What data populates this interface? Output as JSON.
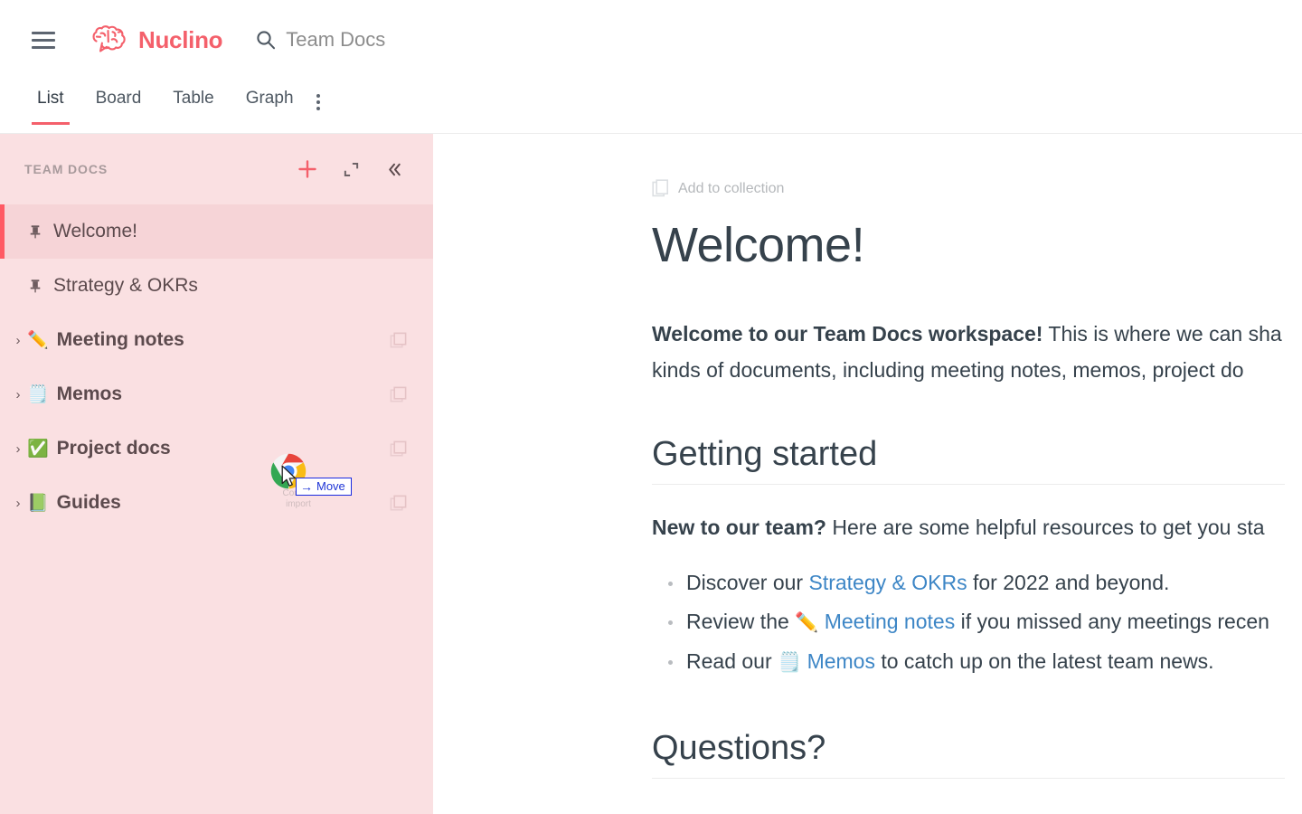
{
  "colors": {
    "brand": "#f4606b",
    "sidebar_bg": "#fae0e2",
    "sidebar_active_bg": "#f6d4d7",
    "active_marker": "#ff5a64",
    "link": "#3d86c6",
    "text": "#36424c",
    "move_badge": "#1f35d6"
  },
  "topbar": {
    "menu_icon": "hamburger-menu-icon",
    "logo_icon": "nuclino-brain-logo-icon",
    "brand_name": "Nuclino",
    "search_icon": "search-icon",
    "search_value": "Team Docs"
  },
  "tabs": {
    "items": [
      {
        "label": "List",
        "active": true
      },
      {
        "label": "Board",
        "active": false
      },
      {
        "label": "Table",
        "active": false
      },
      {
        "label": "Graph",
        "active": false
      }
    ],
    "more_icon": "more-vertical-icon"
  },
  "sidebar": {
    "title": "TEAM DOCS",
    "actions": [
      {
        "name": "add-item-button",
        "icon": "plus-icon"
      },
      {
        "name": "expand-sidebar-button",
        "icon": "expand-icon"
      },
      {
        "name": "collapse-sidebar-button",
        "icon": "chevrons-left-icon"
      }
    ],
    "items": [
      {
        "label": "Welcome!",
        "icon": "pin-icon",
        "emoji": "",
        "caret": false,
        "active": true,
        "bold": false,
        "duplicate": false
      },
      {
        "label": "Strategy & OKRs",
        "icon": "pin-icon",
        "emoji": "",
        "caret": false,
        "active": false,
        "bold": false,
        "duplicate": false
      },
      {
        "label": "Meeting notes",
        "icon": "emoji",
        "emoji": "✏️",
        "caret": true,
        "active": false,
        "bold": true,
        "duplicate": true
      },
      {
        "label": "Memos",
        "icon": "emoji",
        "emoji": "🗒️",
        "caret": true,
        "active": false,
        "bold": true,
        "duplicate": true
      },
      {
        "label": "Project docs",
        "icon": "emoji",
        "emoji": "✅",
        "caret": true,
        "active": false,
        "bold": true,
        "duplicate": true
      },
      {
        "label": "Guides",
        "icon": "emoji",
        "emoji": "📗",
        "caret": true,
        "active": false,
        "bold": true,
        "duplicate": true
      }
    ]
  },
  "drag": {
    "icon": "chrome-browser-icon",
    "cursor": "arrow-cursor-icon",
    "badge_arrow": "→",
    "badge_label": "Move",
    "file_label_line1": "Content",
    "file_label_line2": "import"
  },
  "main": {
    "collection_icon": "collection-icon",
    "collection_label": "Add to collection",
    "title": "Welcome!",
    "intro_bold": "Welcome to our Team Docs workspace!",
    "intro_rest": " This is where we can sha",
    "intro_line2": "kinds of documents, including meeting notes, memos, project do",
    "section1_title": "Getting started",
    "section1_lead_bold": "New to our team?",
    "section1_lead_rest": " Here are some helpful resources to get you sta",
    "bullets": [
      {
        "pre": "Discover our ",
        "emoji": "",
        "link": "Strategy & OKRs",
        "post": " for 2022 and beyond."
      },
      {
        "pre": "Review the ",
        "emoji": "✏️",
        "link": "Meeting notes",
        "post": " if you missed any meetings recen"
      },
      {
        "pre": "Read our ",
        "emoji": "🗒️",
        "link": "Memos",
        "post": " to catch up on the latest team news."
      }
    ],
    "section2_title": "Questions?"
  }
}
